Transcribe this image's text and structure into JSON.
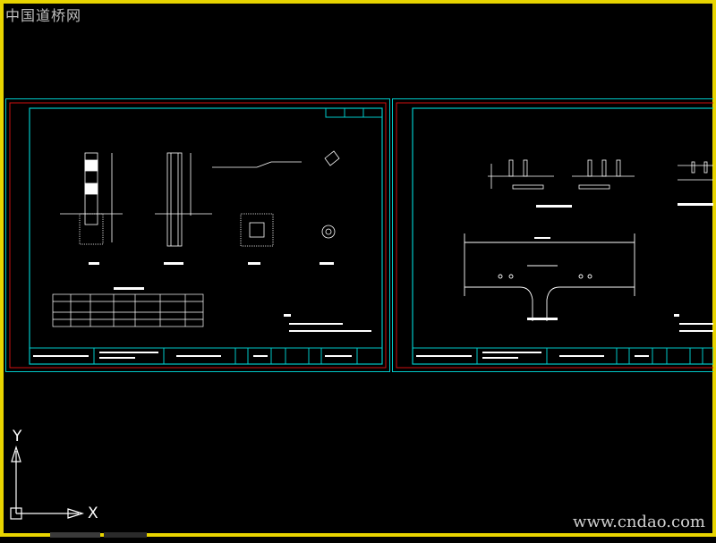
{
  "watermark": {
    "top_left": "中国道桥网",
    "bottom_right": "www.cndao.com"
  },
  "ucs": {
    "y_label": "Y",
    "x_label": "X"
  },
  "colors": {
    "frame": "#e8d400",
    "sheet_border": "#00c8c8",
    "inner_border": "#d01010",
    "drawing": "#ffffff"
  },
  "sheet_left": {
    "title_block": {
      "sheet_no": "1",
      "sheet_total": "1"
    },
    "table": {
      "headers": [
        "",
        "",
        "",
        "",
        "",
        "",
        ""
      ],
      "rows": [
        [
          "",
          "",
          "",
          "",
          "",
          "",
          ""
        ],
        [
          "",
          "",
          "",
          "",
          "",
          "",
          ""
        ],
        [
          "",
          "",
          "",
          "",
          "",
          "",
          ""
        ]
      ]
    }
  },
  "sheet_right": {
    "title_block": {
      "sheet_no": "",
      "sheet_total": ""
    }
  }
}
